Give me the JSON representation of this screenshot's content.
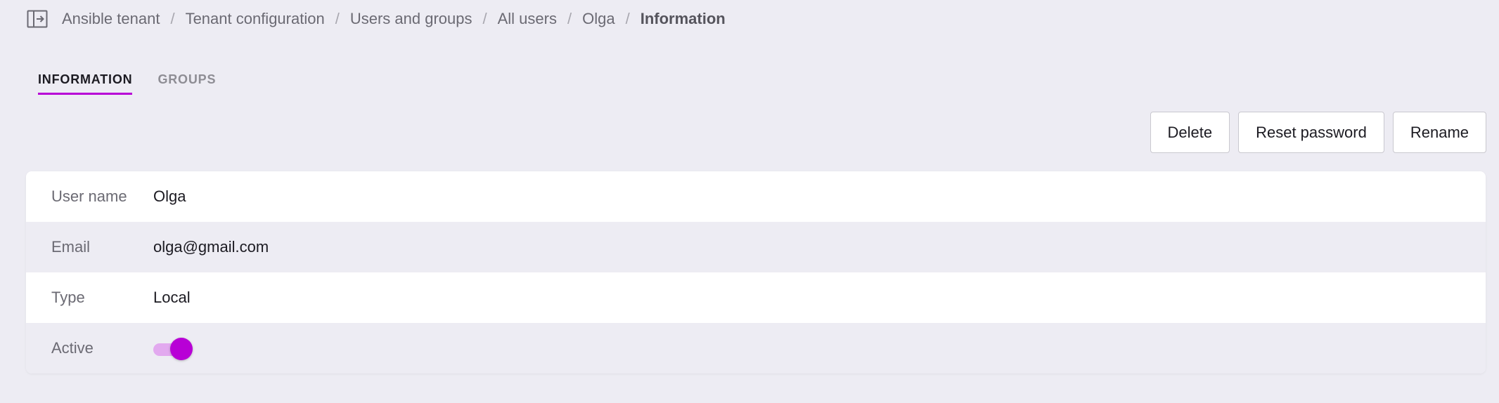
{
  "breadcrumb": {
    "items": [
      "Ansible tenant",
      "Tenant configuration",
      "Users and groups",
      "All users",
      "Olga"
    ],
    "current": "Information",
    "separator": "/"
  },
  "tabs": [
    {
      "label": "INFORMATION",
      "active": true
    },
    {
      "label": "GROUPS",
      "active": false
    }
  ],
  "actions": {
    "delete": "Delete",
    "reset_password": "Reset password",
    "rename": "Rename"
  },
  "details": {
    "user_name": {
      "label": "User name",
      "value": "Olga"
    },
    "email": {
      "label": "Email",
      "value": "olga@gmail.com"
    },
    "type": {
      "label": "Type",
      "value": "Local"
    },
    "active": {
      "label": "Active",
      "value": true
    }
  },
  "icons": {
    "sidebar_toggle": "sidebar-toggle-icon"
  },
  "colors": {
    "accent": "#b800d6",
    "toggle_track": "#e2a9ef",
    "background": "#edecf3"
  }
}
